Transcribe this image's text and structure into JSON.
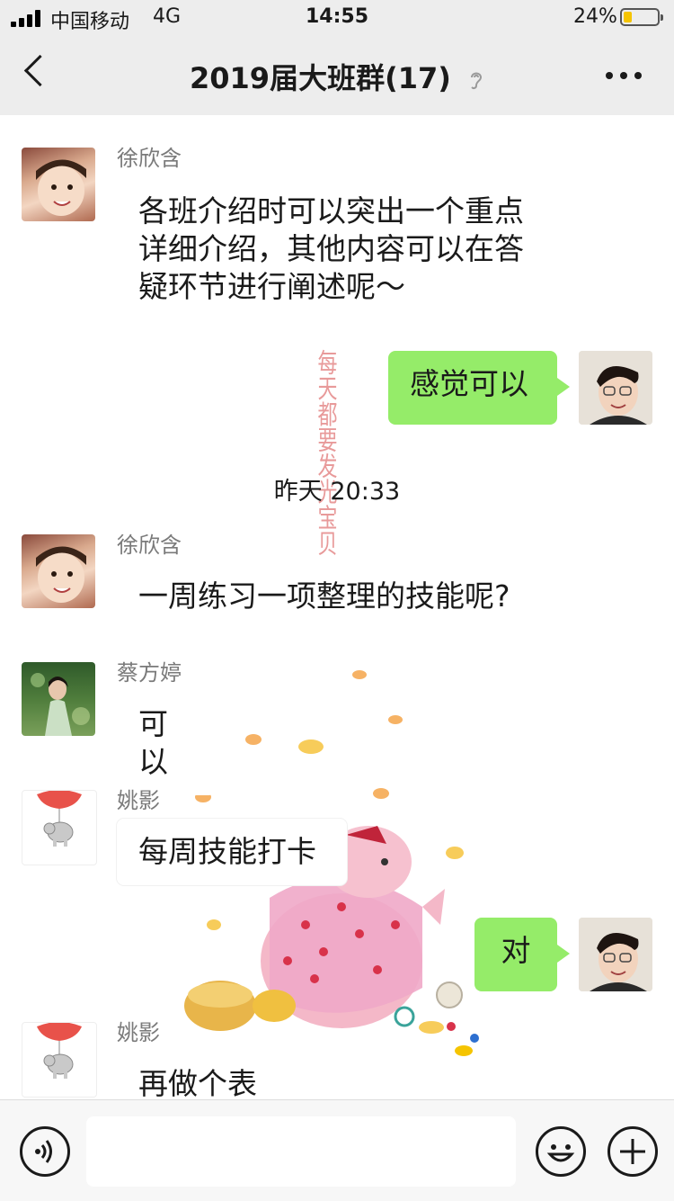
{
  "status_bar": {
    "carrier": "中国移动",
    "network": "4G",
    "time": "14:55",
    "battery_percent": "24%",
    "battery_level": 0.24,
    "battery_color": "#f5c400"
  },
  "nav": {
    "back_icon": "chevron-left-icon",
    "title": "2019届大班群(17)",
    "mute_icon": "ear-muted-icon",
    "more_icon": "more-dots-icon"
  },
  "messages": [
    {
      "sender": "徐欣含",
      "text_lines": [
        "各班介绍时可以突出一个重点",
        "详细介绍，其他内容可以在答",
        "疑环节进行阐述呢～"
      ],
      "direction": "in"
    },
    {
      "text": "感觉可以",
      "direction": "out"
    },
    {
      "timestamp": "昨天 20:33"
    },
    {
      "sender": "徐欣含",
      "text": "一周练习一项整理的技能呢?",
      "direction": "in"
    },
    {
      "sender": "蔡方婷",
      "text": "可以",
      "direction": "in"
    },
    {
      "sender": "姚影",
      "text": "每周技能打卡",
      "direction": "in"
    },
    {
      "text": "对",
      "direction": "out"
    },
    {
      "sender": "姚影",
      "text": "再做个表",
      "direction": "in"
    }
  ],
  "background_text": "每天都要发光宝贝",
  "input_bar": {
    "voice_icon": "voice-icon",
    "emoji_icon": "emoji-icon",
    "plus_icon": "plus-icon"
  },
  "colors": {
    "outgoing_bubble": "#95ec69",
    "header_bg": "#ededed"
  }
}
